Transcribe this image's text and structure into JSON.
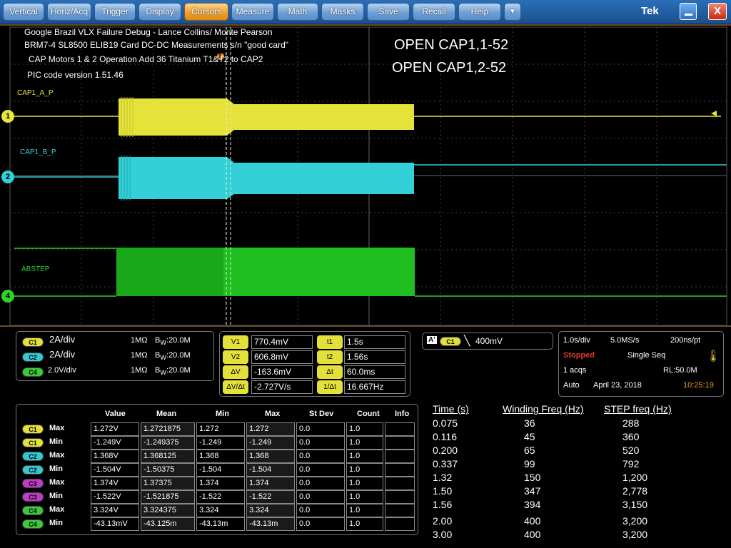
{
  "menu": [
    "Vertical",
    "Horiz/Acq",
    "Trigger",
    "Display",
    "Cursors",
    "Measure",
    "Math",
    "Masks",
    "Save",
    "Recall",
    "Help"
  ],
  "menu_active": "Cursors",
  "dropdown_glyph": "▼",
  "brand": "Tek",
  "close_glyph": "X",
  "notes": {
    "line1": "Google Brazil VLX Failure Debug - Lance Collins/ Monte Pearson",
    "line2": "BRM7-4 SL8500 ELIB19 Card DC-DC Measurements s/n \"good card\"",
    "line3": "CAP Motors 1 & 2 Operation Add 36 Titanium T1&T2 to CAP2",
    "line4": "PIC code version 1.51.46",
    "open1": "OPEN CAP1,1-52",
    "open2": "OPEN CAP1,2-52"
  },
  "channels": {
    "ch1": {
      "label": "CAP1_A_P",
      "num": "1",
      "color": "#e8e63c"
    },
    "ch2": {
      "label": "CAP1_B_P",
      "num": "2",
      "color": "#33d0d8"
    },
    "ch4": {
      "label": "ABSTEP",
      "num": "4",
      "color": "#2fd22f"
    }
  },
  "trigger_marker": "T",
  "vert": [
    {
      "pill": "C1",
      "scale": "2A/div",
      "imp": "1MΩ",
      "bw": "20.0M"
    },
    {
      "pill": "C2",
      "scale": "2A/div",
      "imp": "1MΩ",
      "bw": "20.0M"
    },
    {
      "pill": "C4",
      "scale": "2.0V/div",
      "imp": "1MΩ",
      "bw": "20.0M"
    }
  ],
  "cursors": {
    "v1_label": "V1",
    "v1": "770.4mV",
    "v2_label": "V2",
    "v2": "606.8mV",
    "dv_label": "ΔV",
    "dv": "-163.6mV",
    "dvdt_label": "ΔV/Δt",
    "dvdt": "-2.727V/s",
    "t1_label": "t1",
    "t1": "1.5s",
    "t2_label": "t2",
    "t2": "1.56s",
    "dt_label": "Δt",
    "dt": "60.0ms",
    "inv_label": "1/Δt",
    "inv": "16.667Hz"
  },
  "trigger": {
    "a": "A'",
    "src": "C1",
    "level": "400mV"
  },
  "acq": {
    "tdiv": "1.0s/div",
    "rate": "5.0MS/s",
    "res": "200ns/pt",
    "state": "Stopped",
    "mode": "Single Seq",
    "acqs": "1 acqs",
    "rl": "RL:50.0M",
    "auto": "Auto",
    "date": "April 23, 2018",
    "time": "10:25:19"
  },
  "meas_headers": [
    "Value",
    "Mean",
    "Min",
    "Max",
    "St Dev",
    "Count",
    "Info"
  ],
  "meas_rows": [
    {
      "pill": "C1",
      "type": "Max",
      "value": "1.272V",
      "mean": "1.2721875",
      "min": "1.272",
      "max": "1.272",
      "sd": "0.0",
      "count": "1.0"
    },
    {
      "pill": "C1",
      "type": "Min",
      "value": "-1.249V",
      "mean": "-1.249375",
      "min": "-1.249",
      "max": "-1.249",
      "sd": "0.0",
      "count": "1.0"
    },
    {
      "pill": "C2",
      "type": "Max",
      "value": "1.368V",
      "mean": "1.368125",
      "min": "1.368",
      "max": "1.368",
      "sd": "0.0",
      "count": "1.0"
    },
    {
      "pill": "C2",
      "type": "Min",
      "value": "-1.504V",
      "mean": "-1.50375",
      "min": "-1.504",
      "max": "-1.504",
      "sd": "0.0",
      "count": "1.0"
    },
    {
      "pill": "C3",
      "type": "Max",
      "value": "1.374V",
      "mean": "1.37375",
      "min": "1.374",
      "max": "1.374",
      "sd": "0.0",
      "count": "1.0"
    },
    {
      "pill": "C3",
      "type": "Min",
      "value": "-1.522V",
      "mean": "-1.521875",
      "min": "-1.522",
      "max": "-1.522",
      "sd": "0.0",
      "count": "1.0"
    },
    {
      "pill": "C4",
      "type": "Max",
      "value": "3.324V",
      "mean": "3.324375",
      "min": "3.324",
      "max": "3.324",
      "sd": "0.0",
      "count": "1.0"
    },
    {
      "pill": "C4",
      "type": "Min",
      "value": "-43.13mV",
      "mean": "-43.125m",
      "min": "-43.13m",
      "max": "-43.13m",
      "sd": "0.0",
      "count": "1.0"
    }
  ],
  "step_headers": [
    "Time (s)",
    "Winding Freq (Hz)",
    "STEP freq (Hz)"
  ],
  "step_rows": [
    [
      "0.075",
      "36",
      "288"
    ],
    [
      "0.116",
      "45",
      "360"
    ],
    [
      "0.200",
      "65",
      "520"
    ],
    [
      "0.337",
      "99",
      "792"
    ],
    [
      "1.32",
      "150",
      "1,200"
    ],
    [
      "1.50",
      "347",
      "2,778"
    ],
    [
      "1.56",
      "394",
      "3,150"
    ],
    [
      "2.00",
      "400",
      "3,200"
    ],
    [
      "3.00",
      "400",
      "3,200"
    ]
  ]
}
